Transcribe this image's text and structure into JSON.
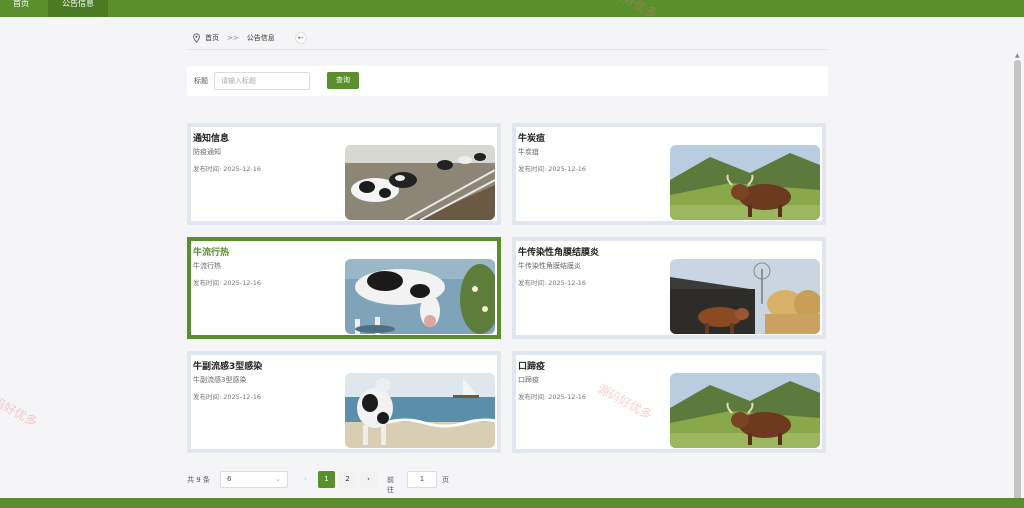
{
  "topnav": {
    "home": "首页",
    "notice": "公告信息"
  },
  "breadcrumb": {
    "home": "首页",
    "separator": ">>",
    "current": "公告信息"
  },
  "search": {
    "label": "标题",
    "placeholder": "请输入标题",
    "button": "查询"
  },
  "cards": [
    {
      "title": "通知信息",
      "subtitle": "防疫通知",
      "date": "发布时间: 2025-12-16",
      "image": "cows-barn"
    },
    {
      "title": "牛炭疽",
      "subtitle": "牛炭疽",
      "date": "发布时间: 2025-12-16",
      "image": "bull-mountain"
    },
    {
      "title": "牛流行热",
      "subtitle": "牛流行热",
      "date": "发布时间: 2025-12-16",
      "image": "cow-drinking"
    },
    {
      "title": "牛传染性角膜结膜炎",
      "subtitle": "牛传染性角膜结膜炎",
      "date": "发布时间: 2025-12-16",
      "image": "cow-windmill-hay"
    },
    {
      "title": "牛副流感3型感染",
      "subtitle": "牛副流感3型感染",
      "date": "发布时间: 2025-12-16",
      "image": "cow-beach"
    },
    {
      "title": "口蹄疫",
      "subtitle": "口蹄疫",
      "date": "发布时间: 2025-12-16",
      "image": "bull-mountain"
    }
  ],
  "pager": {
    "total": "共 9 条",
    "page_size": "6",
    "prev": "‹",
    "pages": [
      "1",
      "2"
    ],
    "next": "›",
    "goto": "前往",
    "jump_value": "1",
    "page_word": "页"
  },
  "watermark": "源码好优多",
  "colors": {
    "brand": "#5b8f2e"
  }
}
